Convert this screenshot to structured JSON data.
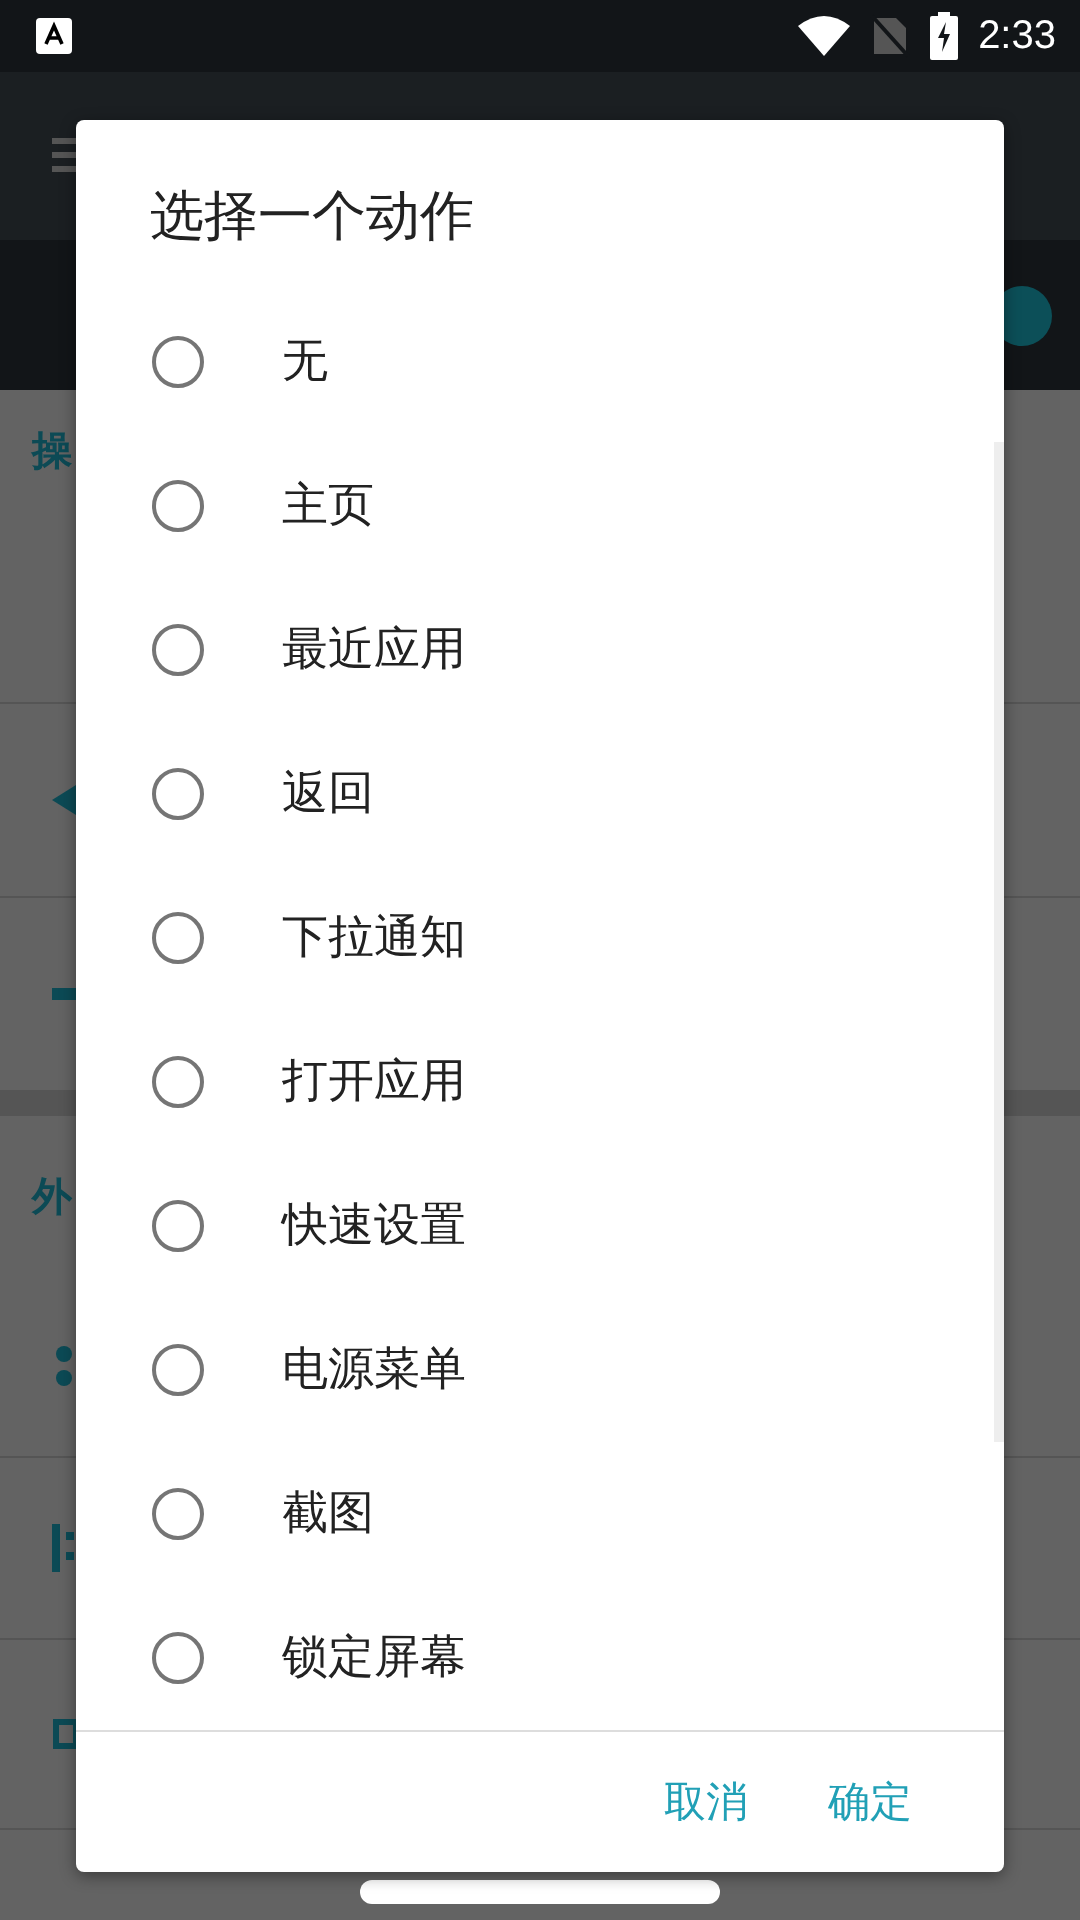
{
  "status_bar": {
    "time": "2:33"
  },
  "background": {
    "sections": [
      {
        "title": "操"
      },
      {
        "title": "外"
      }
    ]
  },
  "dialog": {
    "title": "选择一个动作",
    "options": [
      {
        "label": "无",
        "selected": false
      },
      {
        "label": "主页",
        "selected": false
      },
      {
        "label": "最近应用",
        "selected": false
      },
      {
        "label": "返回",
        "selected": false
      },
      {
        "label": "下拉通知",
        "selected": false
      },
      {
        "label": "打开应用",
        "selected": false
      },
      {
        "label": "快速设置",
        "selected": false
      },
      {
        "label": "电源菜单",
        "selected": false
      },
      {
        "label": "截图",
        "selected": false
      },
      {
        "label": "锁定屏幕",
        "selected": false
      }
    ],
    "buttons": [
      {
        "label": "取消"
      },
      {
        "label": "确定"
      }
    ]
  }
}
